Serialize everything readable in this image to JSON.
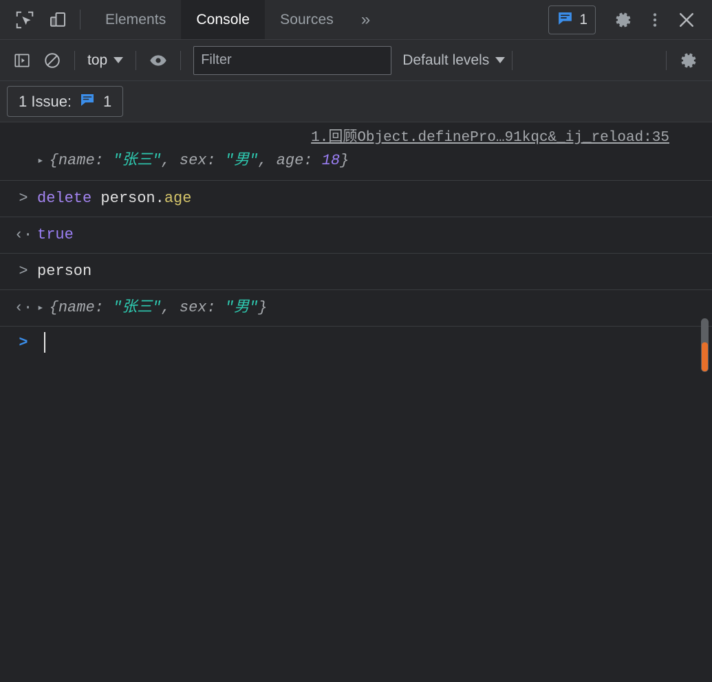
{
  "tabbar": {
    "inspect_icon": "inspect-element-icon",
    "device_icon": "device-toolbar-icon",
    "tabs": [
      {
        "label": "Elements",
        "active": false
      },
      {
        "label": "Console",
        "active": true
      },
      {
        "label": "Sources",
        "active": false
      }
    ],
    "more_label": "»",
    "issues_count": "1",
    "settings_icon": "gear-icon",
    "more_options_icon": "kebab-menu-icon",
    "close_icon": "close-icon"
  },
  "console_toolbar": {
    "sidebar_toggle_icon": "console-sidebar-icon",
    "clear_icon": "clear-console-icon",
    "context_label": "top",
    "eye_icon": "live-expression-eye-icon",
    "filter_placeholder": "Filter",
    "filter_value": "",
    "levels_label": "Default levels",
    "settings_icon": "console-settings-gear-icon"
  },
  "issues_bar": {
    "label": "1 Issue:",
    "icon": "issue-message-icon",
    "count": "1"
  },
  "console": {
    "source_link": "1.回顾Object.definePro…91kqc&_ij_reload:35",
    "entries": [
      {
        "type": "log",
        "disclosure": "▸",
        "object": {
          "open": "{",
          "parts": [
            {
              "key": "name: ",
              "str": "\"张三\"",
              "sep": ", "
            },
            {
              "key": "sex: ",
              "str": "\"男\"",
              "sep": ", "
            },
            {
              "key": "age: ",
              "num": "18",
              "sep": ""
            }
          ],
          "close": "}"
        }
      },
      {
        "type": "input",
        "marker": ">",
        "code": {
          "kw": "delete",
          "space": " ",
          "ident": "person",
          "dot": ".",
          "prop": "age"
        }
      },
      {
        "type": "output",
        "marker": "‹·",
        "value": "true"
      },
      {
        "type": "input",
        "marker": ">",
        "code": {
          "ident": "person"
        }
      },
      {
        "type": "output",
        "marker": "‹·",
        "disclosure": "▸",
        "object": {
          "open": "{",
          "parts": [
            {
              "key": "name: ",
              "str": "\"张三\"",
              "sep": ", "
            },
            {
              "key": "sex: ",
              "str": "\"男\"",
              "sep": ""
            }
          ],
          "close": "}"
        }
      }
    ],
    "prompt_marker": ">",
    "prompt_value": ""
  },
  "colors": {
    "accent_blue": "#3b8eea",
    "issue_orange": "#e8702a",
    "string_teal": "#2ec9b0",
    "number_purple": "#9b7ff5",
    "keyword_purple": "#a384f0",
    "property_yellow": "#d4c46a",
    "background": "#232427",
    "toolbar_background": "#2c2d30"
  }
}
